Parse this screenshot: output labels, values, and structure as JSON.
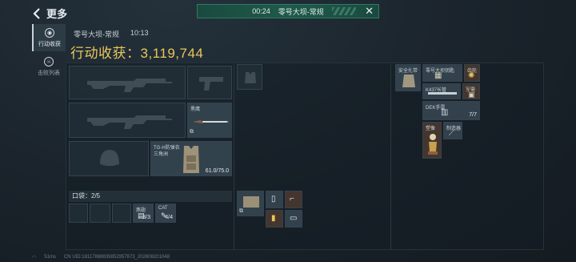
{
  "header": {
    "back_label": "更多"
  },
  "timer": {
    "time": "00:24",
    "map": "零号大坝-常规"
  },
  "nav": {
    "items": [
      {
        "label": "行动收获"
      },
      {
        "label": "击败列表"
      }
    ]
  },
  "session": {
    "map": "零号大坝-常规",
    "clock": "10:13",
    "harvest_label": "行动收获：",
    "harvest_value": "3,119,744"
  },
  "slots": {
    "knife_label": "黑鹰",
    "armor_label": "TG-H防弹衣",
    "armor_sub": "三角洲",
    "armor_durability": "61.0/75.0"
  },
  "pockets": {
    "label": "口袋：",
    "count": "2/5",
    "item1_label": "燕翅",
    "item1_count": "3/3",
    "item2_label": "CAT",
    "item2_count": "4/4"
  },
  "backpack": {
    "item_a": "安全扎带",
    "item_b": "零号大坝钥匙",
    "item_c": "齿轮",
    "item_d": "K437长管",
    "item_e": "军需",
    "item_f": "DEK手雷",
    "item_f_count": "7/7",
    "item_g": "塑像",
    "item_h": "制造器"
  },
  "footer": {
    "ping": "51ms",
    "uid": "CN UID:18117888839852957873_202608201048"
  }
}
